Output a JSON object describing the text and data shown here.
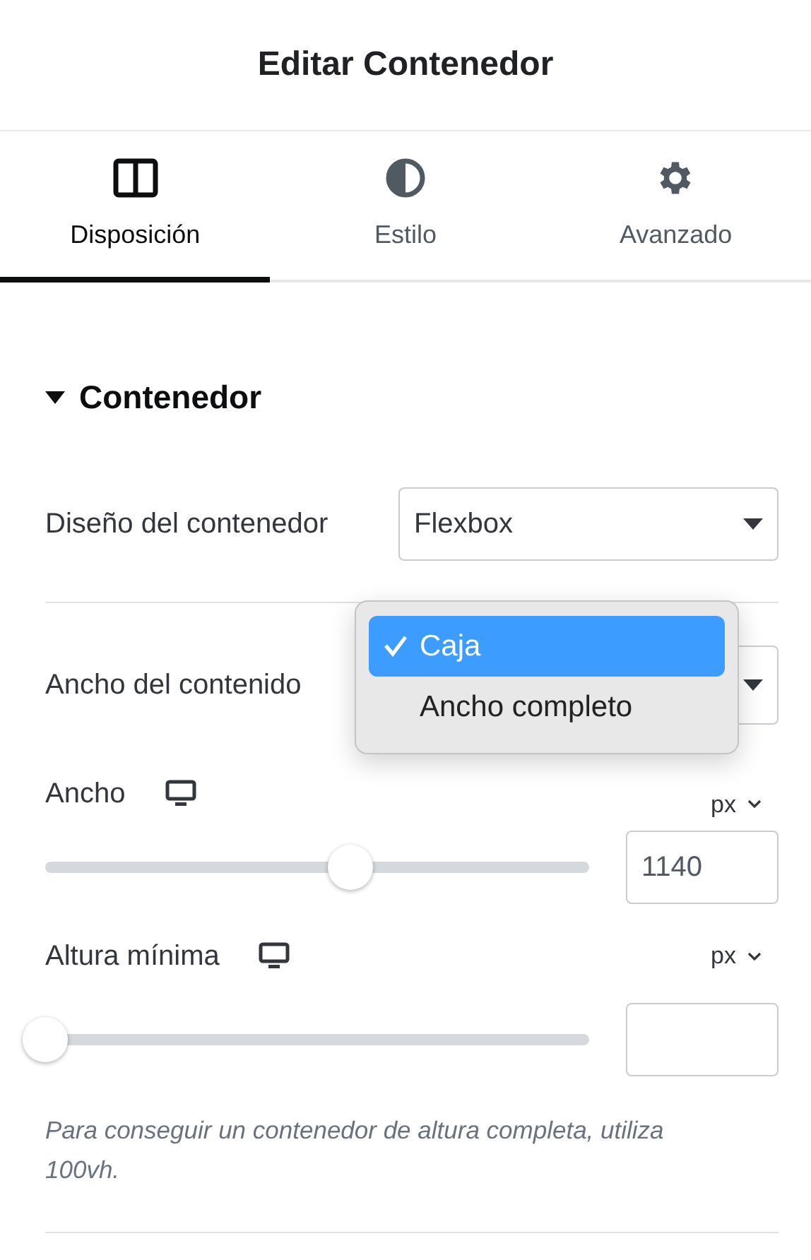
{
  "header": {
    "title": "Editar Contenedor"
  },
  "tabs": [
    {
      "label": "Disposición",
      "selected": true
    },
    {
      "label": "Estilo",
      "selected": false
    },
    {
      "label": "Avanzado",
      "selected": false
    }
  ],
  "section": {
    "title": "Contenedor",
    "expanded": true
  },
  "controls": [
    {
      "kind": "select",
      "label": "Diseño del contenedor",
      "value": "Flexbox"
    },
    {
      "kind": "select-open",
      "label": "Ancho del contenido",
      "options": [
        {
          "label": "Caja",
          "selected": true
        },
        {
          "label": "Ancho completo",
          "selected": false
        }
      ]
    },
    {
      "kind": "slider",
      "label": "Ancho",
      "unit": "px",
      "level": 0.585,
      "value": "1140"
    },
    {
      "kind": "slider",
      "label": "Altura mínima",
      "unit": "px",
      "level": 0
    }
  ],
  "help": "Para conseguir un contenedor de altura completa, utiliza 100vh."
}
